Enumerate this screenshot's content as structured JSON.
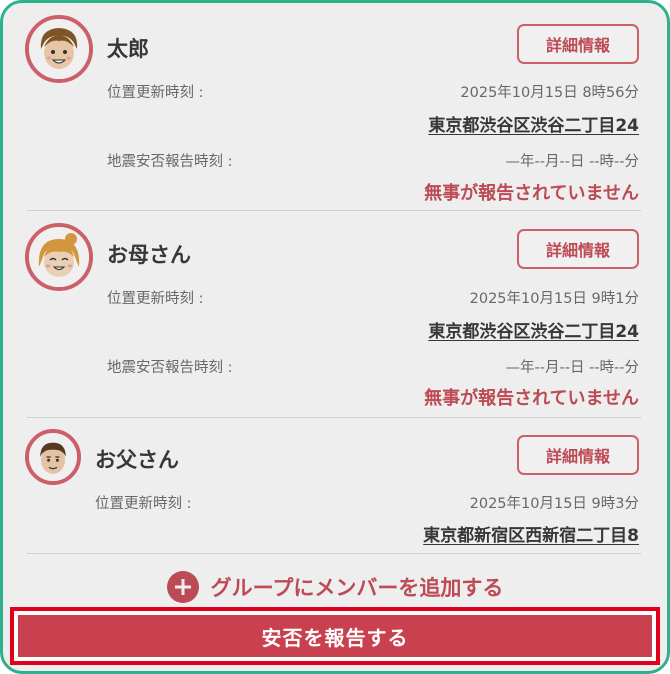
{
  "members": [
    {
      "name": "太郎",
      "detail_label": "詳細情報",
      "location_label": "位置更新時刻 :",
      "location_time": "2025年10月15日 8時56分",
      "address": "東京都渋谷区渋谷二丁目24",
      "quake_label": "地震安否報告時刻 :",
      "quake_time": "—年--月--日 --時--分",
      "status": "無事が報告されていません"
    },
    {
      "name": "お母さん",
      "detail_label": "詳細情報",
      "location_label": "位置更新時刻 :",
      "location_time": "2025年10月15日 9時1分",
      "address": "東京都渋谷区渋谷二丁目24",
      "quake_label": "地震安否報告時刻 :",
      "quake_time": "—年--月--日 --時--分",
      "status": "無事が報告されていません"
    },
    {
      "name": "お父さん",
      "detail_label": "詳細情報",
      "location_label": "位置更新時刻 :",
      "location_time": "2025年10月15日 9時3分",
      "address": "東京都新宿区西新宿二丁目8"
    }
  ],
  "add_member_label": "グループにメンバーを追加する",
  "report_button_label": "安否を報告する",
  "colors": {
    "accent": "#c9505b",
    "frame": "#2fb08d",
    "highlight": "#e0001a"
  },
  "icons": {
    "avatar_1": "boy-avatar-icon",
    "avatar_2": "mother-avatar-icon",
    "avatar_3": "father-avatar-icon",
    "add": "plus-icon"
  }
}
